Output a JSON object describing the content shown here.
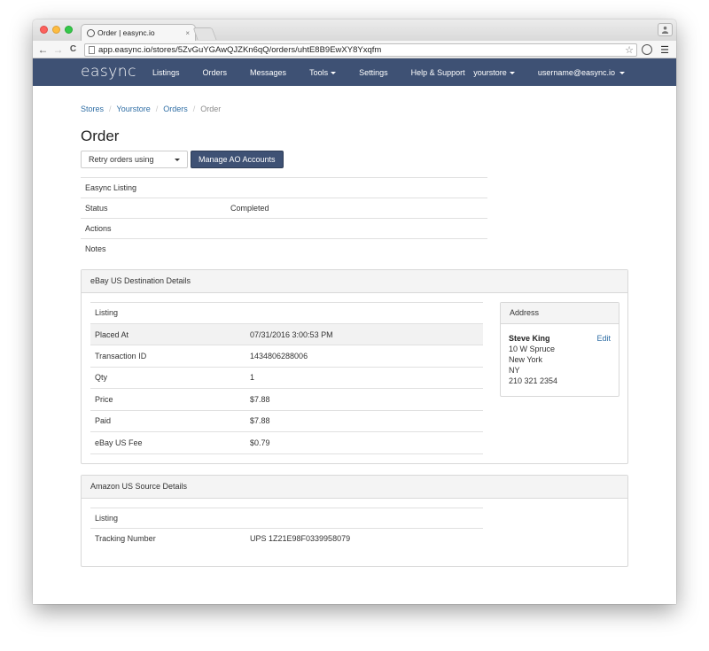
{
  "browser": {
    "tab_title": "Order | easync.io",
    "tab_close": "×",
    "url": "app.easync.io/stores/5ZvGuYGAwQJZKn6qQ/orders/uhtE8B9EwXY8Yxqfm",
    "back": "←",
    "forward": "→",
    "reload": "C",
    "star": "☆",
    "menu": "☰"
  },
  "nav": {
    "logo": "easync",
    "items": [
      "Listings",
      "Orders",
      "Messages",
      "Tools",
      "Settings",
      "Help & Support"
    ],
    "store": "yourstore",
    "user": "username@easync.io"
  },
  "breadcrumb": [
    "Stores",
    "Yourstore",
    "Orders",
    "Order"
  ],
  "page": {
    "title": "Order",
    "retry_select": "Retry orders using",
    "manage_button": "Manage AO Accounts"
  },
  "summary": [
    {
      "key": "Easync Listing",
      "value": ""
    },
    {
      "key": "Status",
      "value": "Completed"
    },
    {
      "key": "Actions",
      "value": ""
    },
    {
      "key": "Notes",
      "value": ""
    }
  ],
  "destination": {
    "heading": "eBay US Destination Details",
    "rows": [
      {
        "key": "Listing",
        "value": ""
      },
      {
        "key": "Placed At",
        "value": "07/31/2016 3:00:53 PM"
      },
      {
        "key": "Transaction ID",
        "value": "1434806288006"
      },
      {
        "key": "Qty",
        "value": "1"
      },
      {
        "key": "Price",
        "value": "$7.88"
      },
      {
        "key": "Paid",
        "value": "$7.88"
      },
      {
        "key": "eBay US Fee",
        "value": "$0.79"
      }
    ],
    "address": {
      "heading": "Address",
      "edit": "Edit",
      "name": "Steve King",
      "line1": "10 W Spruce",
      "line2": "New York",
      "line3": "NY",
      "phone": "210 321 2354"
    }
  },
  "source": {
    "heading": "Amazon US Source Details",
    "rows": [
      {
        "key": "Listing",
        "value": ""
      },
      {
        "key": "Tracking Number",
        "value": "UPS 1Z21E98F0339958079"
      }
    ]
  },
  "colors": {
    "navbar": "#3e5174",
    "link": "#2e6da4"
  }
}
